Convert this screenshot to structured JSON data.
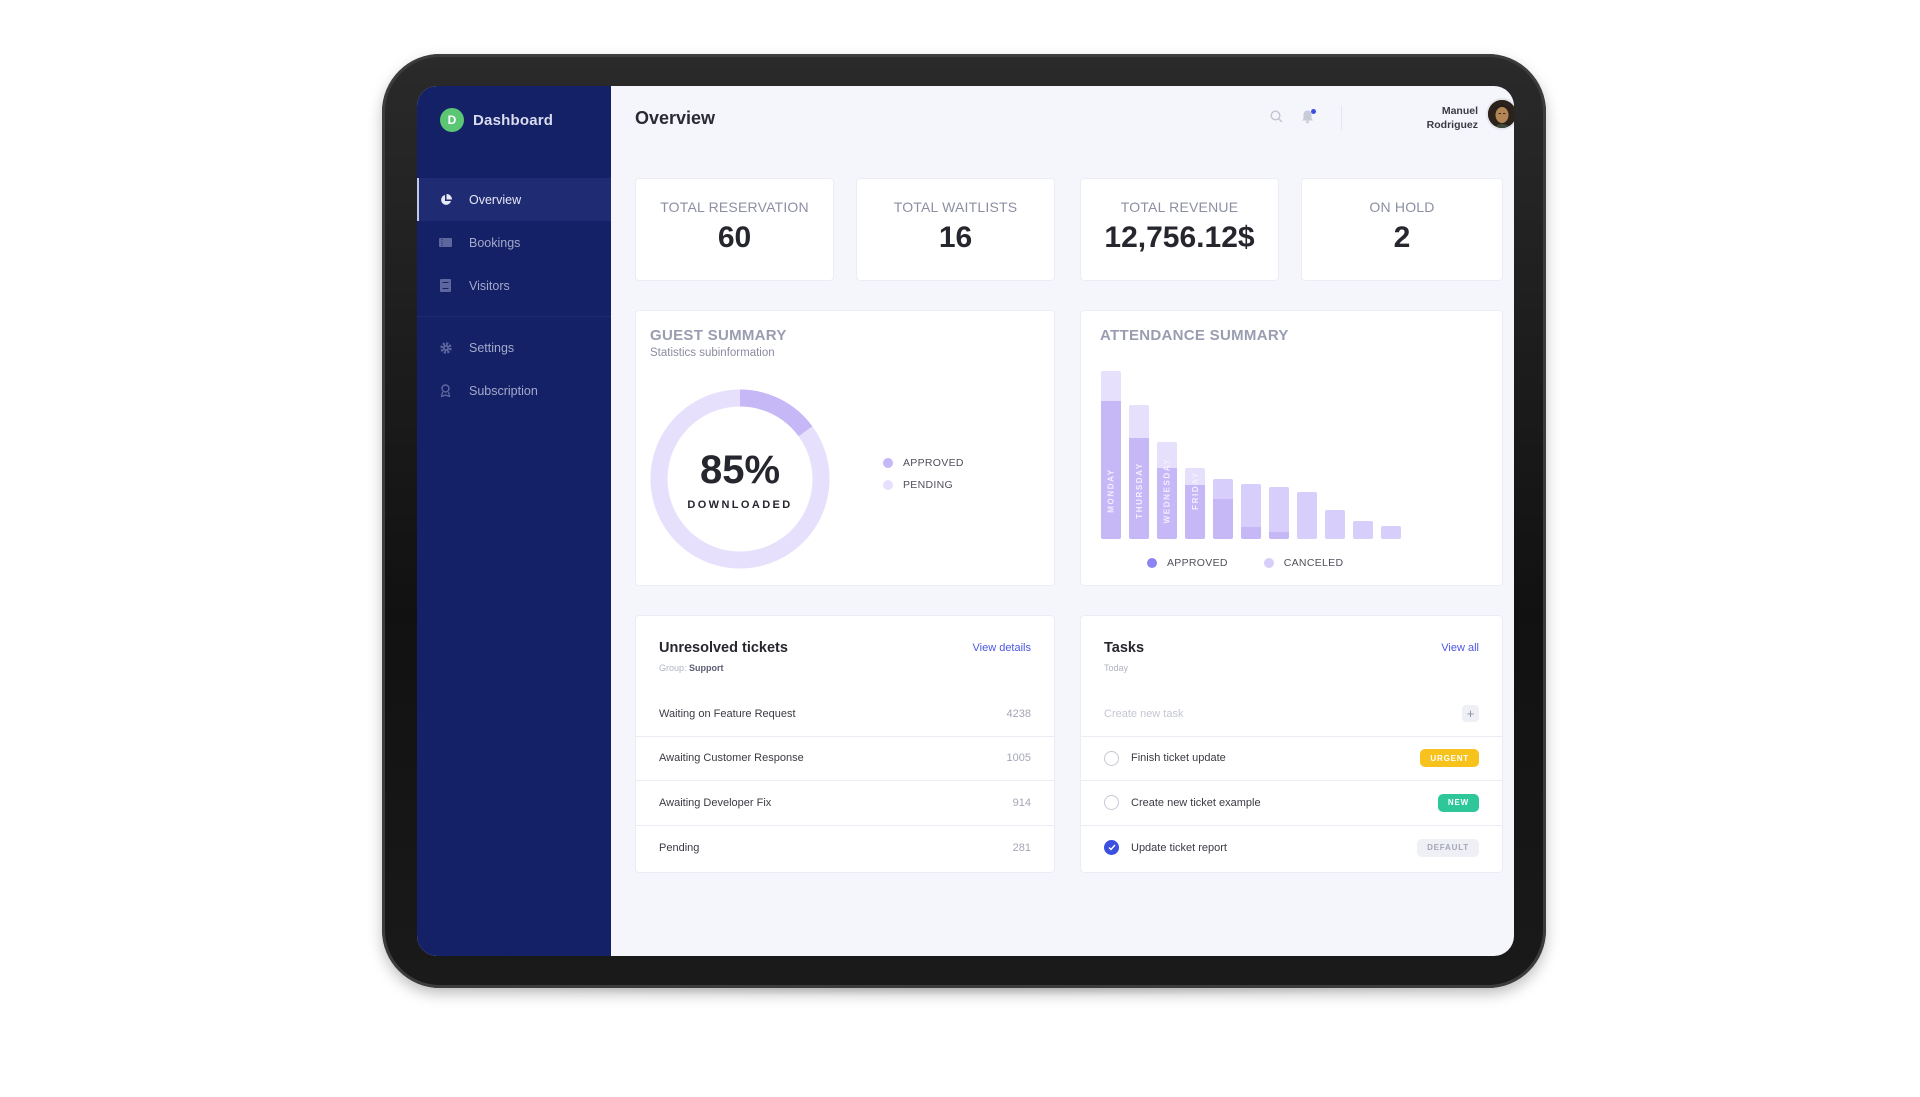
{
  "app": {
    "brand_initial": "D",
    "brand_name": "Dashboard"
  },
  "colors": {
    "sidebar_bg": "#152166",
    "brand_green": "#5bc775",
    "accent_blue": "#3c50e0",
    "approved": "#c6b7f7",
    "pending": "#e6e0fc",
    "urgent": "#f7c21c",
    "new": "#2ec79a",
    "default": "#eef0f6"
  },
  "sidebar": {
    "items": [
      {
        "label": "Overview",
        "icon": "pie-chart-icon",
        "active": true
      },
      {
        "label": "Bookings",
        "icon": "ticket-icon",
        "active": false
      },
      {
        "label": "Visitors",
        "icon": "book-icon",
        "active": false
      },
      {
        "label": "Settings",
        "icon": "gear-icon",
        "active": false
      },
      {
        "label": "Subscription",
        "icon": "award-icon",
        "active": false
      }
    ]
  },
  "header": {
    "title": "Overview",
    "user": {
      "first": "Manuel",
      "last": "Rodriguez"
    }
  },
  "stats": [
    {
      "label": "TOTAL RESERVATION",
      "value": "60"
    },
    {
      "label": "TOTAL WAITLISTS",
      "value": "16"
    },
    {
      "label": "TOTAL REVENUE",
      "value": "12,756.12$"
    },
    {
      "label": "ON HOLD",
      "value": "2"
    }
  ],
  "guest_summary": {
    "title": "GUEST SUMMARY",
    "subtitle": "Statistics subinformation",
    "percent_label": "85%",
    "center_caption": "DOWNLOADED",
    "legend": [
      {
        "label": "APPROVED"
      },
      {
        "label": "PENDING"
      }
    ]
  },
  "attendance": {
    "title": "ATTENDANCE SUMMARY",
    "legend": [
      {
        "label": "APPROVED"
      },
      {
        "label": "CANCELED"
      }
    ]
  },
  "chart_data": [
    {
      "type": "pie",
      "title": "GUEST SUMMARY",
      "center_text": "85%",
      "center_caption": "DOWNLOADED",
      "slices": [
        {
          "name": "APPROVED",
          "value": 15
        },
        {
          "name": "PENDING",
          "value": 85
        }
      ]
    },
    {
      "type": "bar",
      "stacked": true,
      "title": "ATTENDANCE SUMMARY",
      "categories": [
        "MONDAY",
        "THURSDAY",
        "WEDNESDAY",
        "FRIDAY",
        "",
        "",
        "",
        "",
        "",
        "",
        ""
      ],
      "series": [
        {
          "name": "APPROVED",
          "values": [
            82,
            60,
            42,
            32,
            24,
            7,
            4,
            0,
            0,
            0,
            0
          ]
        },
        {
          "name": "CANCELED",
          "values": [
            18,
            20,
            16,
            10,
            12,
            26,
            27,
            28,
            17,
            11,
            8
          ]
        }
      ],
      "ylim": [
        0,
        100
      ],
      "legend": "bottom"
    }
  ],
  "tickets": {
    "title": "Unresolved tickets",
    "link": "View details",
    "group_label": "Group:",
    "group_value": "Support",
    "rows": [
      {
        "label": "Waiting on Feature Request",
        "count": "4238"
      },
      {
        "label": "Awaiting Customer Response",
        "count": "1005"
      },
      {
        "label": "Awaiting Developer Fix",
        "count": "914"
      },
      {
        "label": "Pending",
        "count": "281"
      }
    ]
  },
  "tasks": {
    "title": "Tasks",
    "link": "View all",
    "subtitle": "Today",
    "input_placeholder": "Create new task",
    "items": [
      {
        "label": "Finish ticket update",
        "done": false,
        "badge": "URGENT",
        "badge_type": "urgent"
      },
      {
        "label": "Create new ticket example",
        "done": false,
        "badge": "NEW",
        "badge_type": "new"
      },
      {
        "label": "Update ticket report",
        "done": true,
        "badge": "DEFAULT",
        "badge_type": "default"
      }
    ]
  }
}
